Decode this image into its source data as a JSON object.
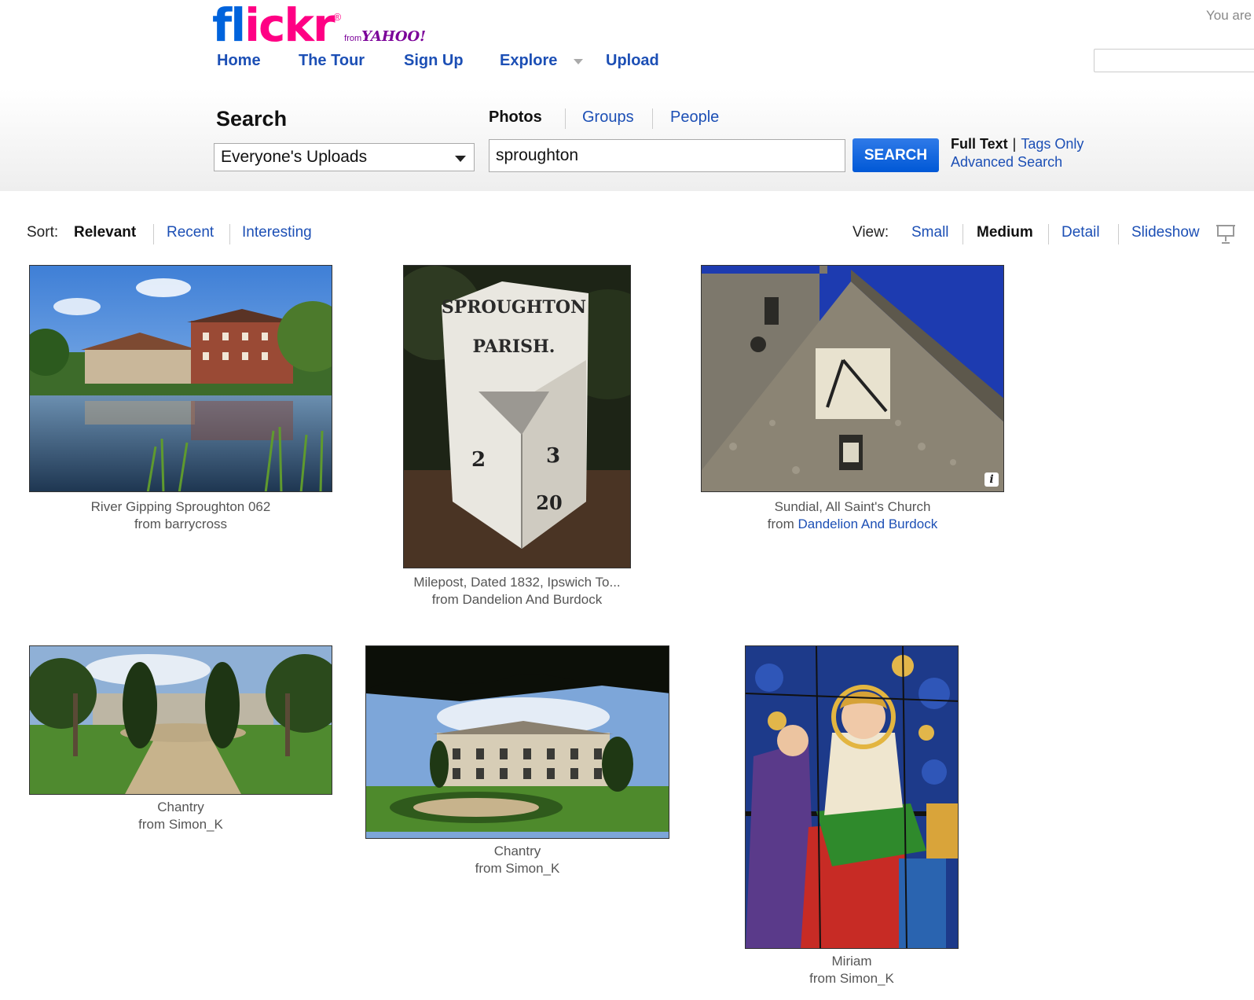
{
  "header": {
    "logo": {
      "flickr_fl": "fl",
      "flickr_kr": "ickr",
      "from": "from",
      "yahoo": "YAHOO!"
    },
    "you_are": "You are",
    "nav": [
      {
        "label": "Home"
      },
      {
        "label": "The Tour"
      },
      {
        "label": "Sign Up"
      },
      {
        "label": "Explore"
      },
      {
        "label": "Upload"
      }
    ]
  },
  "search": {
    "title": "Search",
    "tabs": [
      {
        "label": "Photos",
        "active": true
      },
      {
        "label": "Groups",
        "active": false
      },
      {
        "label": "People",
        "active": false
      }
    ],
    "scope_selected": "Everyone's Uploads",
    "query": "sproughton",
    "button": "SEARCH",
    "full_text": "Full Text",
    "tags_only": "Tags Only",
    "advanced": "Advanced Search"
  },
  "sort": {
    "label": "Sort:",
    "options": [
      {
        "label": "Relevant",
        "active": true
      },
      {
        "label": "Recent",
        "active": false
      },
      {
        "label": "Interesting",
        "active": false
      }
    ]
  },
  "view": {
    "label": "View:",
    "options": [
      {
        "label": "Small",
        "active": false
      },
      {
        "label": "Medium",
        "active": true
      },
      {
        "label": "Detail",
        "active": false
      },
      {
        "label": "Slideshow",
        "active": false
      }
    ]
  },
  "photos": [
    {
      "title": "River Gipping Sproughton 062",
      "from": "from",
      "owner": "barrycross",
      "owner_linked": false,
      "icon": "river-mill-photo"
    },
    {
      "title": "Milepost, Dated 1832, Ipswich To...",
      "from": "from",
      "owner": "Dandelion And Burdock",
      "owner_linked": false,
      "icon": "milepost-photo",
      "milepost_top": "SPROUGHTON",
      "milepost_mid": "PARISH."
    },
    {
      "title": "Sundial, All Saint's Church",
      "from": "from",
      "owner": "Dandelion And Burdock",
      "owner_linked": true,
      "icon": "church-sundial-photo",
      "info_label": "i"
    },
    {
      "title": "Chantry",
      "from": "from",
      "owner": "Simon_K",
      "owner_linked": false,
      "icon": "garden-trees-photo"
    },
    {
      "title": "Chantry",
      "from": "from",
      "owner": "Simon_K",
      "owner_linked": false,
      "icon": "mansion-photo"
    },
    {
      "title": "Miriam",
      "from": "from",
      "owner": "Simon_K",
      "owner_linked": false,
      "icon": "stained-glass-photo"
    }
  ],
  "colors": {
    "flickr_blue": "#0063dc",
    "flickr_pink": "#ff0084",
    "yahoo_purple": "#7b0099",
    "link_blue": "#1c4fb5",
    "button_blue": "#0058d6"
  }
}
